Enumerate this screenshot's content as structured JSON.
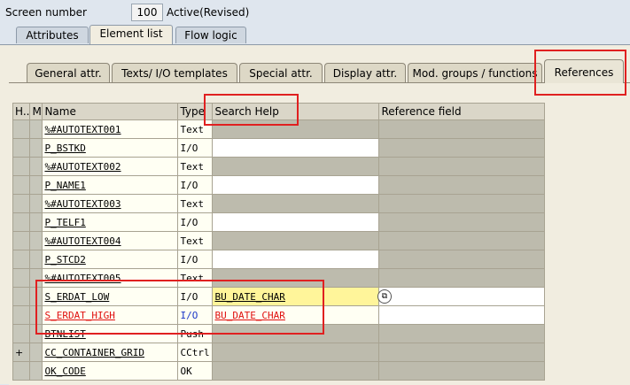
{
  "header": {
    "screen_number_label": "Screen number",
    "screen_number_value": "100",
    "status": "Active(Revised)"
  },
  "outer_tabs": [
    {
      "label": "Attributes"
    },
    {
      "label": "Element list"
    },
    {
      "label": "Flow logic"
    }
  ],
  "inner_tabs": [
    {
      "label": "General attr."
    },
    {
      "label": "Texts/ I/O templates"
    },
    {
      "label": "Special attr."
    },
    {
      "label": "Display attr."
    },
    {
      "label": "Mod. groups / functions"
    },
    {
      "label": "References"
    }
  ],
  "table": {
    "columns": [
      "H..",
      "M",
      "Name",
      "Type",
      "Search Help",
      "Reference field"
    ],
    "rows": [
      {
        "sel": "",
        "name": "%#AUTOTEXT001",
        "type": "Text",
        "search_help": "",
        "ref": ""
      },
      {
        "sel": "",
        "name": "P_BSTKD",
        "type": "I/O",
        "search_help": "",
        "ref": ""
      },
      {
        "sel": "",
        "name": "%#AUTOTEXT002",
        "type": "Text",
        "search_help": "",
        "ref": ""
      },
      {
        "sel": "",
        "name": "P_NAME1",
        "type": "I/O",
        "search_help": "",
        "ref": ""
      },
      {
        "sel": "",
        "name": "%#AUTOTEXT003",
        "type": "Text",
        "search_help": "",
        "ref": ""
      },
      {
        "sel": "",
        "name": "P_TELF1",
        "type": "I/O",
        "search_help": "",
        "ref": ""
      },
      {
        "sel": "",
        "name": "%#AUTOTEXT004",
        "type": "Text",
        "search_help": "",
        "ref": ""
      },
      {
        "sel": "",
        "name": "P_STCD2",
        "type": "I/O",
        "search_help": "",
        "ref": ""
      },
      {
        "sel": "",
        "name": "%#AUTOTEXT005",
        "type": "Text",
        "search_help": "",
        "ref": ""
      },
      {
        "sel": "",
        "name": "S_ERDAT_LOW",
        "type": "I/O",
        "search_help": "BU_DATE_CHAR",
        "ref": ""
      },
      {
        "sel": "",
        "name": "S_ERDAT_HIGH",
        "type": "I/O",
        "search_help": "BU_DATE_CHAR",
        "ref": ""
      },
      {
        "sel": "",
        "name": "BTNLIST",
        "type": "Push",
        "search_help": "",
        "ref": ""
      },
      {
        "sel": "+",
        "name": "CC_CONTAINER_GRID",
        "type": "CCtrl",
        "search_help": "",
        "ref": ""
      },
      {
        "sel": "",
        "name": "OK_CODE",
        "type": "OK",
        "search_help": "",
        "ref": ""
      }
    ]
  },
  "colors": {
    "highlight": "#e02020",
    "error_text": "#e01010",
    "io_blue": "#1a36c8",
    "focus_yellow": "#fff59a"
  }
}
